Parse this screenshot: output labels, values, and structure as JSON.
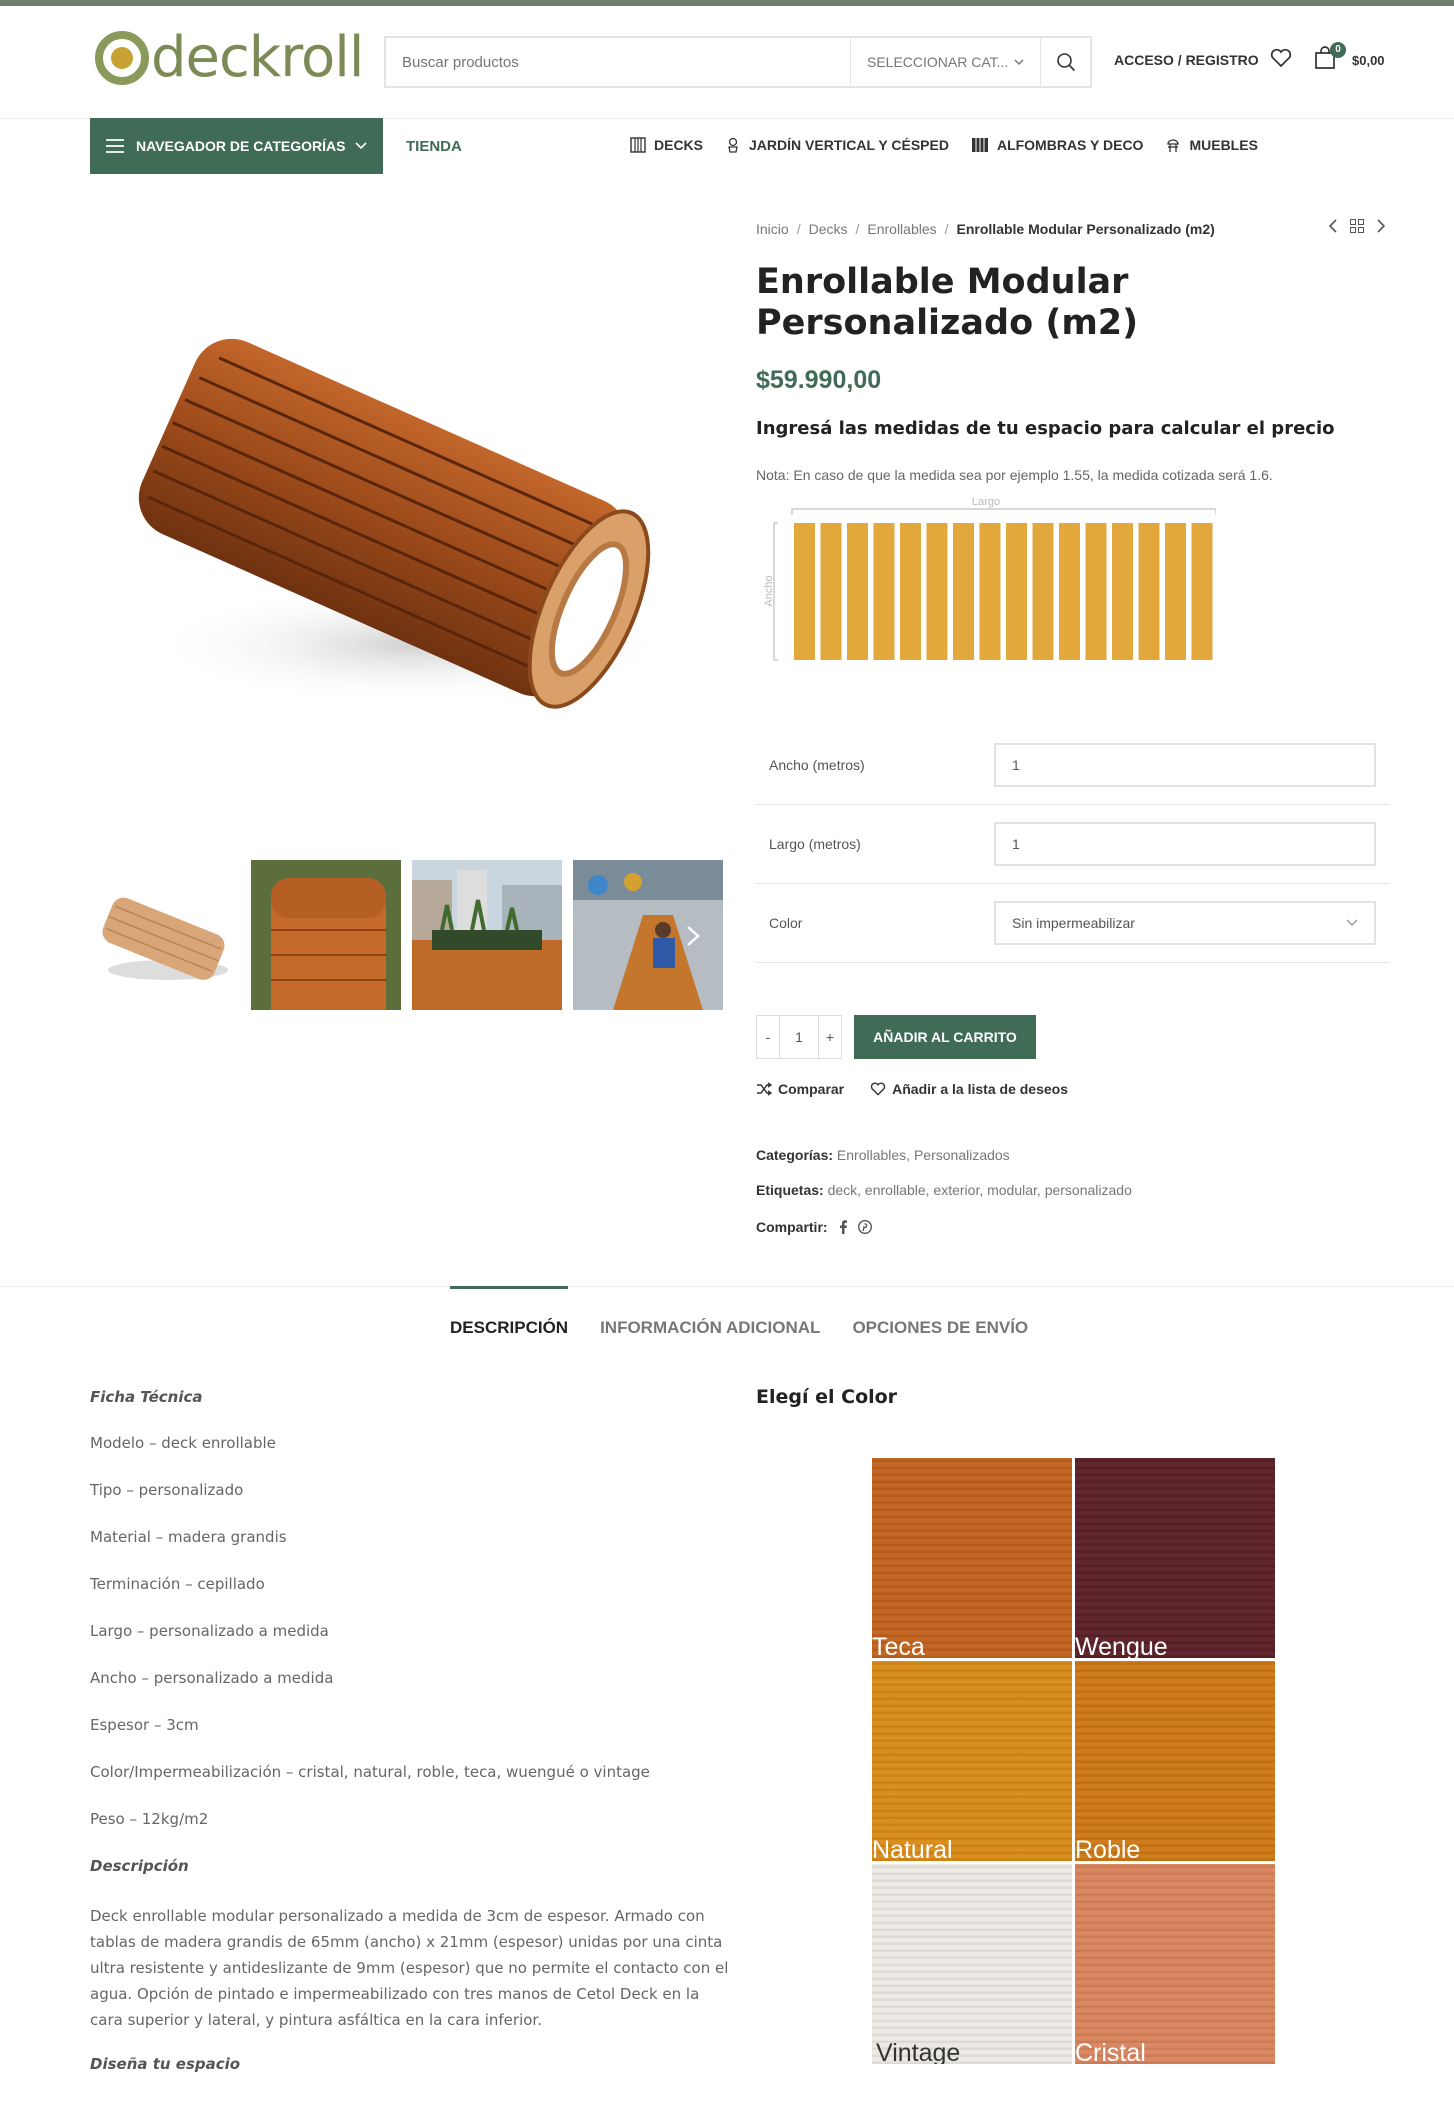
{
  "header": {
    "logo_text": "deckroll",
    "search_placeholder": "Buscar productos",
    "category_select": "SELECCIONAR CAT...",
    "login": "ACCESO / REGISTRO",
    "cart_count": "0",
    "cart_total": "$0,00"
  },
  "nav": {
    "categories_button": "NAVEGADOR DE CATEGORÍAS",
    "tienda": "TIENDA",
    "links": [
      {
        "label": "DECKS",
        "icon": "deck-icon"
      },
      {
        "label": "JARDÍN VERTICAL Y CÉSPED",
        "icon": "plant-icon"
      },
      {
        "label": "ALFOMBRAS Y DECO",
        "icon": "rug-icon"
      },
      {
        "label": "MUEBLES",
        "icon": "chair-icon"
      }
    ]
  },
  "breadcrumb": [
    "Inicio",
    "Decks",
    "Enrollables",
    "Enrollable Modular Personalizado (m2)"
  ],
  "product": {
    "title": "Enrollable Modular Personalizado (m2)",
    "price": "$59.990,00",
    "calc_title": "Ingresá las medidas de tu espacio para calcular el precio",
    "nota": "Nota: En caso de que la medida sea por ejemplo 1.55, la medida cotizada será 1.6.",
    "diagram_labels": {
      "largo": "Largo",
      "ancho": "Ancho"
    }
  },
  "form": {
    "ancho_label": "Ancho (metros)",
    "ancho_value": "1",
    "largo_label": "Largo (metros)",
    "largo_value": "1",
    "color_label": "Color",
    "color_value": "Sin impermeabilizar"
  },
  "cart": {
    "minus": "-",
    "qty": "1",
    "plus": "+",
    "add_button": "AÑADIR AL CARRITO",
    "compare": "Comparar",
    "wishlist": "Añadir a la lista de deseos"
  },
  "meta": {
    "categories_label": "Categorías:",
    "categories": "Enrollables, Personalizados",
    "tags_label": "Etiquetas:",
    "tags": "deck, enrollable, exterior, modular, personalizado",
    "share_label": "Compartir:"
  },
  "tabs": [
    "DESCRIPCIÓN",
    "INFORMACIÓN ADICIONAL",
    "OPCIONES DE ENVÍO"
  ],
  "description": {
    "ficha_title": "Ficha Técnica",
    "specs": [
      "Modelo – deck enrollable",
      "Tipo – personalizado",
      "Material – madera grandis",
      "Terminación – cepillado",
      "Largo – personalizado a medida",
      "Ancho – personalizado a medida",
      "Espesor – 3cm",
      "Color/Impermeabilización – cristal, natural, roble, teca, wuengué o vintage",
      "Peso – 12kg/m2"
    ],
    "desc_title": "Descripción",
    "desc_text": "Deck enrollable modular personalizado a medida de 3cm de espesor. Armado con tablas de madera grandis de 65mm (ancho) x 21mm (espesor) unidas por una cinta ultra resistente y antideslizante de 9mm (espesor) que no permite el contacto con el agua. Opción de pintado e impermeabilizado con tres manos de Cetol Deck en la cara superior y lateral, y pintura asfáltica en la cara inferior.",
    "disena_title": "Diseña tu espacio"
  },
  "colors": {
    "title": "Elegí el Color",
    "swatches": [
      {
        "label": "Teca",
        "color": "#c0611c"
      },
      {
        "label": "Wengue",
        "color": "#5a1f26"
      },
      {
        "label": "Natural",
        "color": "#d88a16"
      },
      {
        "label": "Roble",
        "color": "#cc7713"
      },
      {
        "label": "Vintage",
        "color": "#ece8e2"
      },
      {
        "label": "Cristal",
        "color": "#d9835c"
      }
    ]
  },
  "accent": "#3f6b57"
}
